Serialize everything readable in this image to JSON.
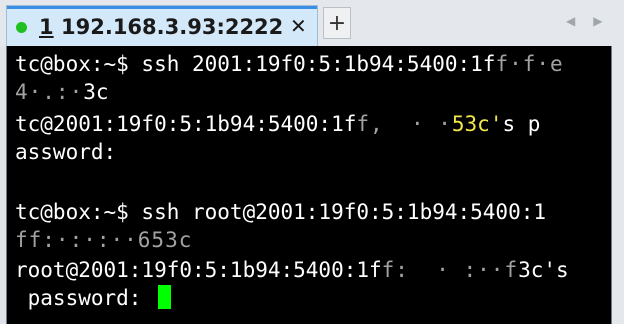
{
  "tab": {
    "number": "1",
    "title": "192.168.3.93:2222",
    "close_label": "✕",
    "status_color": "#20c020"
  },
  "toolbar": {
    "new_tab_label": "+",
    "scroll_left_label": "◀",
    "scroll_right_label": "▶"
  },
  "terminal": {
    "lines": [
      {
        "a": "tc@box:~$ ssh 2001:19f0:5:1b94:5400:1f",
        "b": "f·f·e"
      },
      {
        "a": "",
        "b": "4·.:·",
        "c": "3c"
      },
      {
        "a": "tc@2001:19f0:5:1b94:5400:1f",
        "b": "f,  · ·",
        "y": "53c'",
        "c": "s p"
      },
      {
        "a": "assword:"
      },
      {
        "a": ""
      },
      {
        "a": "tc@box:~$ ssh root@2001:19f0:5:1b94:5400:1"
      },
      {
        "a": "",
        "b": "ff:·:·:··653c"
      },
      {
        "a": "root@2001:19f0:5:1b94:5400:1f",
        "b": "f:  · :··f",
        "c": "3c's"
      },
      {
        "a": " password: "
      }
    ],
    "cursor_color": "#00ff00"
  }
}
